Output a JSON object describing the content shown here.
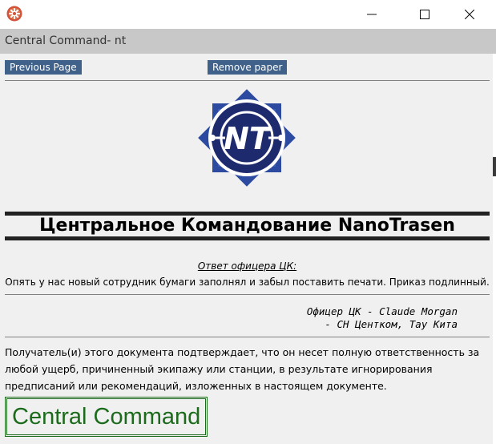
{
  "window": {
    "icon": "cog-app-icon",
    "caption": "Central Command- nt"
  },
  "toolbar": {
    "previous_label": "Previous Page",
    "remove_label": "Remove paper"
  },
  "logo": {
    "text": "NT",
    "colors": {
      "navy": "#1e2a6e",
      "blue": "#2c4aa0",
      "white": "#ffffff"
    }
  },
  "document": {
    "org_title": "Центральное Командование NanoTrasen",
    "response_label": "Ответ офицера ЦК:",
    "message": "Опять у нас новый сотрудник бумаги заполнял и забыл поставить печати. Приказ подлинный.",
    "signature_line1": "Офицер ЦК - Claude Morgan",
    "signature_line2": "- СН Центком, Тау Кита",
    "disclaimer": "Получатель(и) этого документа подтверждает, что он несет полную ответственность за любой ущерб, причиненный экипажу или станции, в результате игнорирования предписаний или рекомендаций, изложенных в настоящем документе.",
    "stamp": "Central Command"
  },
  "colors": {
    "button": "#40628a",
    "caption_bar": "#c8c8c8",
    "stamp": "#1c6b1c"
  }
}
